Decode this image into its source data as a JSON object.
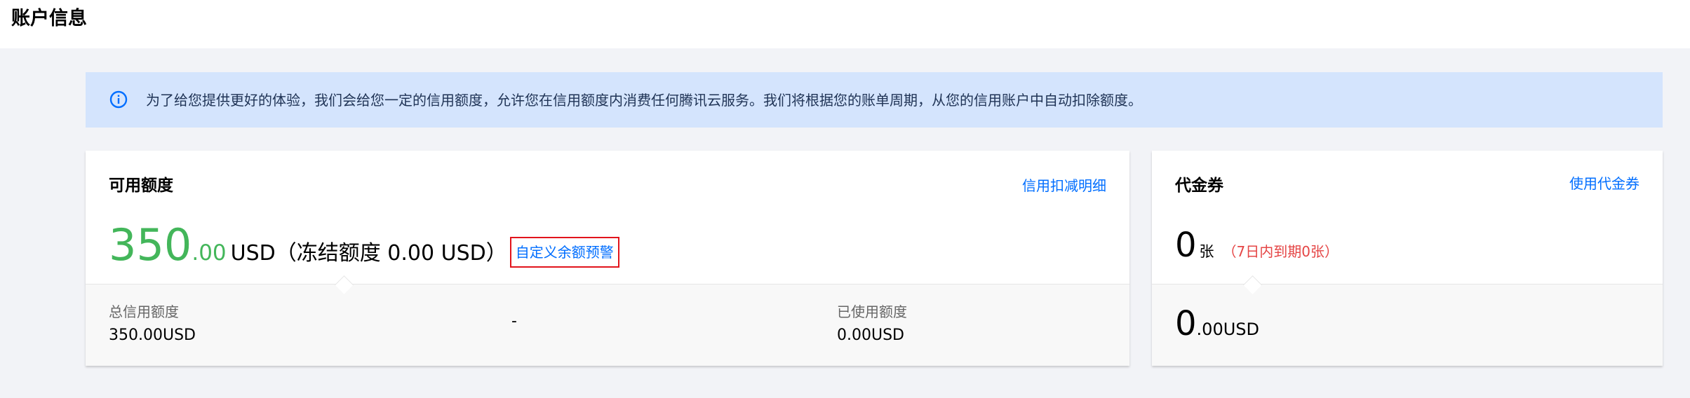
{
  "page": {
    "title": "账户信息"
  },
  "notice": {
    "icon": "info-icon",
    "text": "为了给您提供更好的体验，我们会给您一定的信用额度，允许您在信用额度内消费任何腾讯云服务。我们将根据您的账单周期，从您的信用账户中自动扣除额度。"
  },
  "credit_card": {
    "title": "可用额度",
    "detail_link": "信用扣减明细",
    "available_int": "350",
    "available_dec": ".00",
    "currency": "USD",
    "frozen_text": "（冻结额度 0.00 USD）",
    "alert_link": "自定义余额预警",
    "total_label": "总信用额度",
    "total_value": "350.00USD",
    "separator": "-",
    "used_label": "已使用额度",
    "used_value": "0.00USD"
  },
  "voucher_card": {
    "title": "代金券",
    "use_link": "使用代金券",
    "count": "0",
    "unit": "张",
    "expire_text": "（7日内到期0张）",
    "amount_int": "0",
    "amount_dec": ".00USD"
  },
  "colors": {
    "accent_blue": "#006eff",
    "available_green": "#43b65a",
    "warning_red": "#e54545",
    "highlight_border": "#e2141c",
    "notice_bg": "#d4e4fd"
  }
}
